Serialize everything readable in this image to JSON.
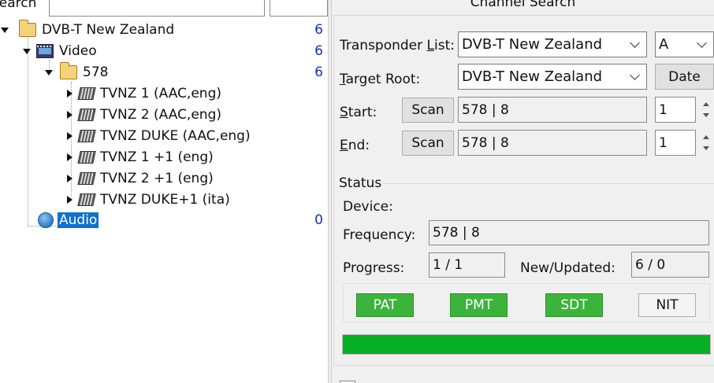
{
  "search": {
    "label": "Search",
    "placeholder": ""
  },
  "tree": {
    "root": {
      "label": "DVB-T New Zealand",
      "count": "6"
    },
    "video": {
      "label": "Video",
      "count": "6"
    },
    "folder": {
      "label": "578",
      "count": "6"
    },
    "channels": [
      {
        "label": "TVNZ 1 (AAC,eng)"
      },
      {
        "label": "TVNZ 2 (AAC,eng)"
      },
      {
        "label": "TVNZ DUKE (AAC,eng)"
      },
      {
        "label": "TVNZ 1 +1 (eng)"
      },
      {
        "label": "TVNZ 2 +1 (eng)"
      },
      {
        "label": "TVNZ DUKE+1 (ita)"
      }
    ],
    "audio": {
      "label": "Audio",
      "count": "0"
    }
  },
  "panel": {
    "title": "Channel Search",
    "transponder_list": {
      "label_pre": "Transponder ",
      "label_u": "L",
      "label_post": "ist:",
      "value": "DVB-T New Zealand",
      "side_value": "A"
    },
    "target_root": {
      "label_u": "T",
      "label_post": "arget Root:",
      "value": "DVB-T New Zealand",
      "button": "Date"
    },
    "start": {
      "label_u": "S",
      "label_post": "tart:",
      "scan": "Scan",
      "value": "578 | 8",
      "spin": "1"
    },
    "end": {
      "label_u": "E",
      "label_post": "nd:",
      "scan": "Scan",
      "value": "578 | 8",
      "spin": "1"
    },
    "status": {
      "title": "Status",
      "device_label": "Device:",
      "frequency_label": "Frequency:",
      "frequency_value": "578 | 8",
      "progress_label": "Progress:",
      "progress_value": "1 / 1",
      "new_updated_label": "New/Updated:",
      "new_updated_value": "6 / 0",
      "tables": [
        {
          "label": "PAT",
          "active": true
        },
        {
          "label": "PMT",
          "active": true
        },
        {
          "label": "SDT",
          "active": true
        },
        {
          "label": "NIT",
          "active": false
        }
      ],
      "progress_fraction": 1.0
    }
  },
  "colors": {
    "active_table": "#3cb43c",
    "progress": "#06b025",
    "selection": "#1070d0",
    "count": "#1a2fb0"
  }
}
